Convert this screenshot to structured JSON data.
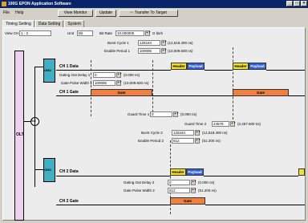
{
  "app": {
    "title": "100G EPON Application Software",
    "controls": [
      "_",
      "□",
      "×"
    ]
  },
  "menu": [
    "File",
    "Help"
  ],
  "toolbar": {
    "view_monitor": "View Monitor",
    "update": "Update",
    "transfer": "Transfer To Target"
  },
  "tabs": [
    "Timing Setting",
    "Data Setting",
    "System"
  ],
  "settings": {
    "view_ch_label": "View CH",
    "view_ch_value": "1 - 2",
    "unit_label": "Unit",
    "unit_value": "Bit",
    "bit_rate_label": "Bit Rate",
    "bit_rate_value": "10.000000",
    "bit_rate_unit": "G bit/s"
  },
  "params": {
    "burst_cycle_1": {
      "label": "Burst Cycle 1",
      "value": "125184",
      "ns": "(12,518.400 ns)"
    },
    "enable_period_1": {
      "label": "Enable Period 1",
      "value": "100096",
      "ns": "(10,009.600 ns)"
    },
    "gating_out_delay_1": {
      "label": "Gating Out Delay 1",
      "value": "0",
      "ns": "(0.000 ns)"
    },
    "gate_pulse_width_1": {
      "label": "Gate Pulse Width 1",
      "value": "100096",
      "ns": "(10,009.600 ns)"
    },
    "guard_time_1": {
      "label": "Guard Time 1",
      "value": "0",
      "ns": "(0.000 ns)"
    },
    "guard_time_2": {
      "label": "Guard Time 2",
      "value": "24576",
      "ns": "(2,457.600 ns)"
    },
    "burst_cycle_2": {
      "label": "Burst Cycle 2",
      "value": "125184",
      "ns": "(12,518.400 ns)"
    },
    "enable_period_2": {
      "label": "Enable Period 2",
      "value": "512",
      "ns": "(51.200 ns)"
    },
    "gating_out_delay_2": {
      "label": "Gating Out Delay 2",
      "value": "0",
      "ns": "(0.000 ns)"
    },
    "gate_pulse_width_2": {
      "label": "Gate Pulse Width 2",
      "value": "512",
      "ns": "(51.200 ns)"
    }
  },
  "diagram": {
    "olt": "OLT",
    "sg": "SG",
    "onu": "ONU",
    "ch1_data": "CH 1 Data",
    "ch1_gate": "CH 1 Gate",
    "ch2_data": "CH 2 Data",
    "ch2_gate": "CH 2 Gate",
    "header": "Header",
    "payload": "Payload",
    "gate": "Gate"
  },
  "colors": {
    "header": "#f0e030",
    "payload": "#3060d0",
    "gate": "#f08040",
    "onu": "#40b0c0",
    "olt": "#f0d0f0"
  }
}
